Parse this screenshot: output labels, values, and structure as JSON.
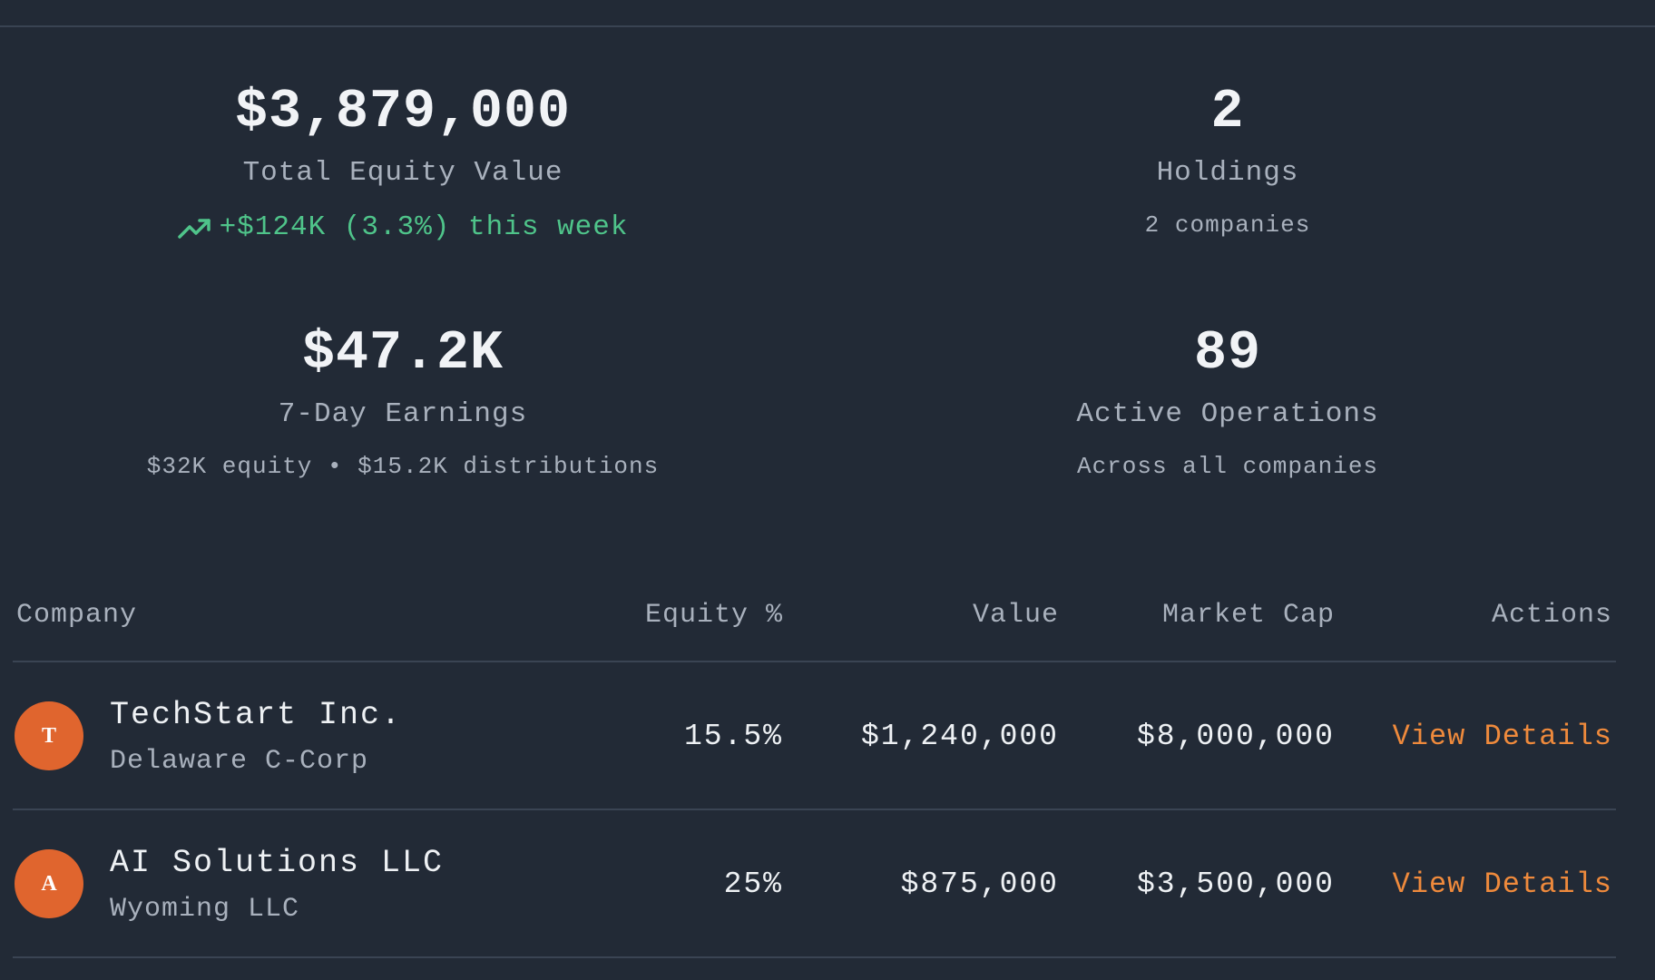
{
  "stats": {
    "total_equity": {
      "value": "$3,879,000",
      "label": "Total Equity Value",
      "change": "+$124K (3.3%) this week",
      "change_icon": "trending-up-icon",
      "change_color": "#4fc48a"
    },
    "holdings": {
      "value": "2",
      "label": "Holdings",
      "sub": "2 companies"
    },
    "earnings": {
      "value": "$47.2K",
      "label": "7-Day Earnings",
      "sub": "$32K equity • $15.2K distributions"
    },
    "operations": {
      "value": "89",
      "label": "Active Operations",
      "sub": "Across all companies"
    }
  },
  "table": {
    "headers": {
      "company": "Company",
      "equity": "Equity %",
      "value": "Value",
      "market_cap": "Market Cap",
      "actions": "Actions"
    },
    "rows": [
      {
        "initial": "T",
        "name": "TechStart Inc.",
        "type": "Delaware C-Corp",
        "equity": "15.5%",
        "value": "$1,240,000",
        "market_cap": "$8,000,000",
        "action": "View Details"
      },
      {
        "initial": "A",
        "name": "AI Solutions LLC",
        "type": "Wyoming LLC",
        "equity": "25%",
        "value": "$875,000",
        "market_cap": "$3,500,000",
        "action": "View Details"
      }
    ]
  },
  "colors": {
    "background": "#222a36",
    "accent": "#ef8a3c",
    "avatar": "#e0652e",
    "positive": "#4fc48a"
  }
}
